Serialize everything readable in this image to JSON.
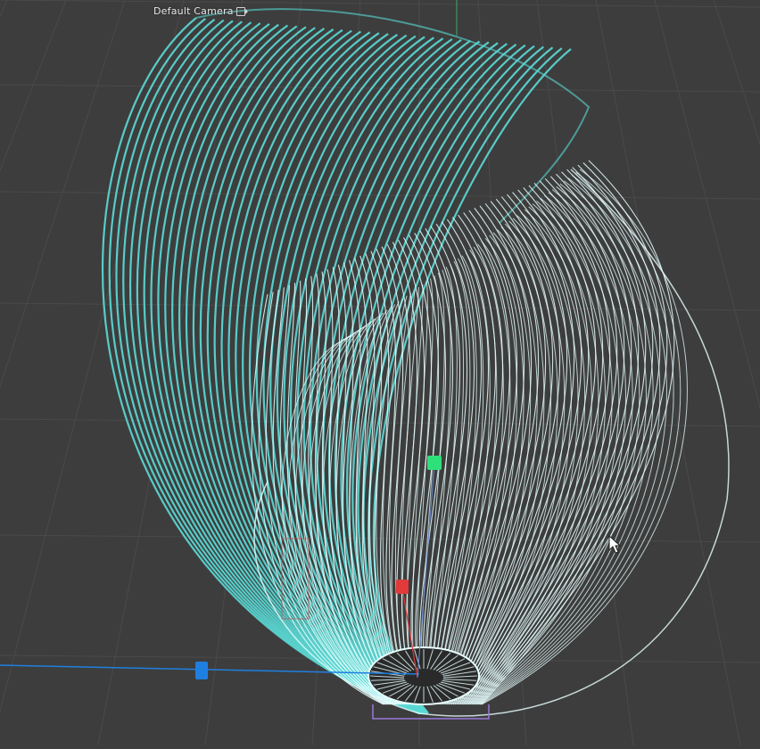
{
  "viewport": {
    "camera_label": "Default Camera",
    "camera_icon": "camera-icon"
  },
  "colors": {
    "background": "#3d3d3d",
    "grid": "#4a4a4a",
    "wire_back": "#5ad8d4",
    "wire_front": "#e8ffff",
    "handle_x": "#e23a3a",
    "handle_y": "#2fe07a",
    "handle_z": "#1f7fe0"
  },
  "icons": {
    "cursor": "arrow-cursor-icon"
  }
}
